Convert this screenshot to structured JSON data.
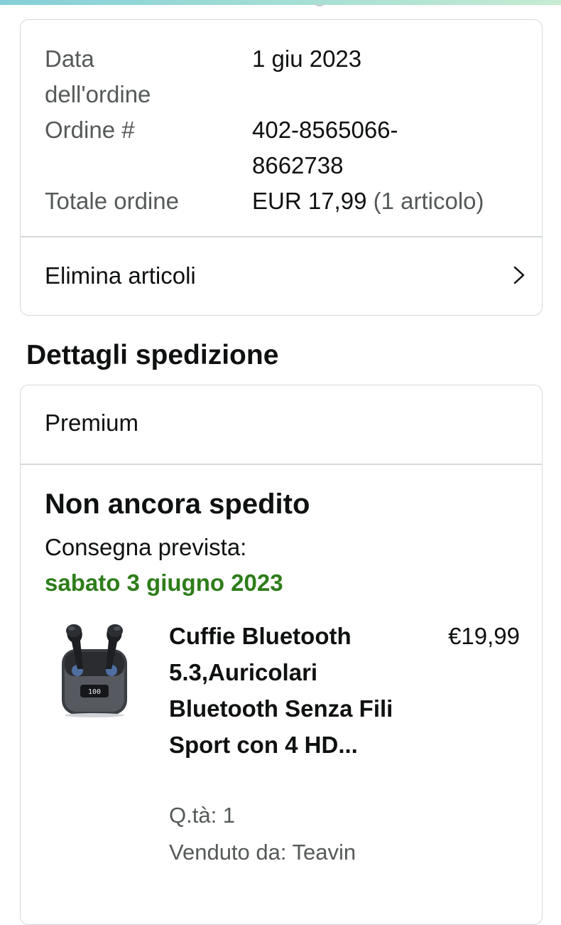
{
  "order_summary": {
    "order_date_label": "Data\ndell'ordine",
    "order_date_value": "1 giu 2023",
    "order_number_label": "Ordine #",
    "order_number_value": "402-8565066-\n8662738",
    "order_total_label": "Totale ordine",
    "order_total_amount": "EUR 17,99",
    "order_total_items": "(1 articolo)",
    "remove_items_label": "Elimina articoli",
    "remove_items_icon": "chevron-right-icon"
  },
  "shipping": {
    "section_title": "Dettagli spedizione",
    "service_label": "Premium",
    "status": "Non ancora spedito",
    "delivery_label": "Consegna prevista:",
    "delivery_date": "sabato 3 giugno 2023",
    "delivery_date_color": "#2e7d1a"
  },
  "item": {
    "title": "Cuffie Bluetooth 5.3,Auricolari Bluetooth Senza Fili Sport con 4 HD...",
    "price": "€19,99",
    "quantity": "Q.tà: 1",
    "seller": "Venduto da: Teavin",
    "image_icon": "earbuds-product-image",
    "case_display_text": "100"
  }
}
